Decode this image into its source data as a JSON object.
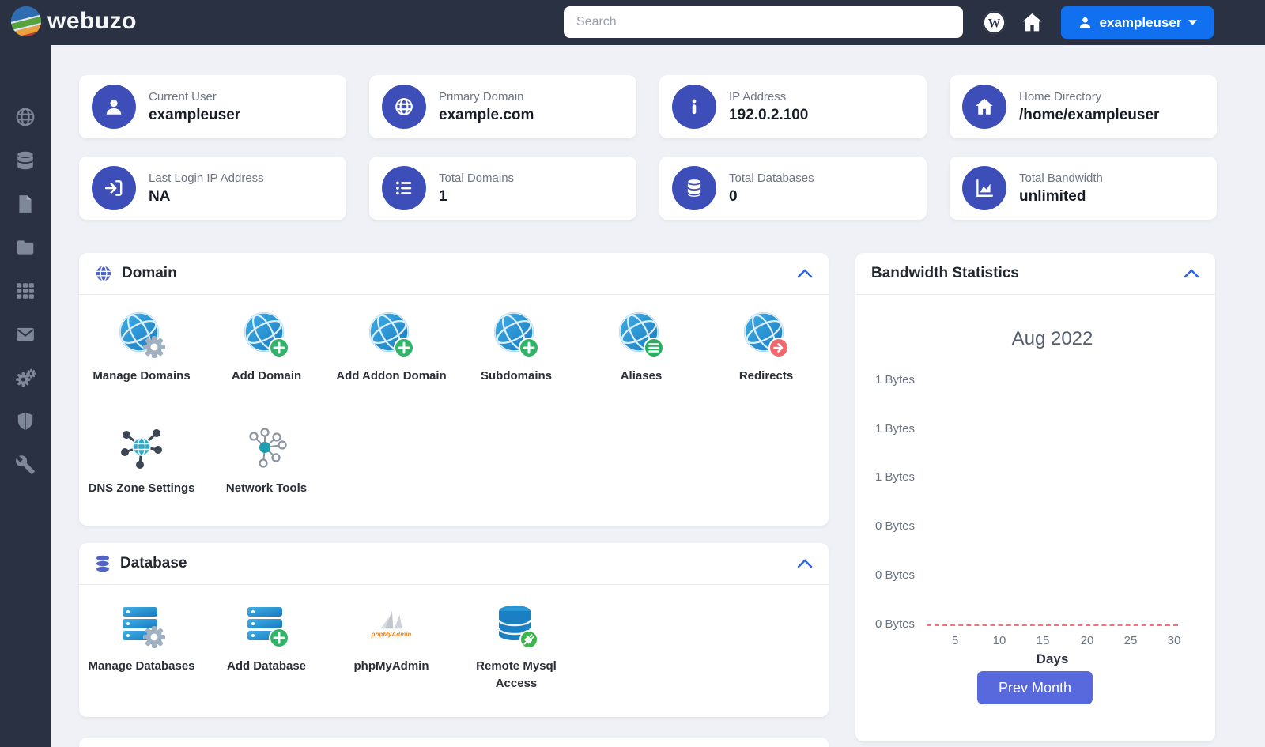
{
  "colors": {
    "topbar_bg": "#2a3142",
    "content_bg": "#eff1f6",
    "accent_blue": "#1170f0",
    "card_icon_bg": "#3d4eb8",
    "panel_header_icon": "#5163c5",
    "chevron_blue": "#2d66e4",
    "button_indigo": "#5868dd",
    "chart_dashed_line": "#f0737c",
    "tile_globe_blue": "#2196d3",
    "badge_green": "#2fb46a",
    "badge_red": "#ef6a6e",
    "badge_gear_gray": "#9fb0c0"
  },
  "topbar": {
    "logo_text": "webuzo",
    "search": {
      "placeholder": "Search"
    },
    "icons": [
      "wordpress-icon",
      "home-icon"
    ],
    "user_menu": {
      "label": "exampleuser",
      "icon": "user-icon",
      "has_dropdown": true
    }
  },
  "sidebar": {
    "items": [
      {
        "icon": "globe-icon"
      },
      {
        "icon": "database-icon"
      },
      {
        "icon": "file-icon"
      },
      {
        "icon": "folder-icon"
      },
      {
        "icon": "apps-grid-icon"
      },
      {
        "icon": "mail-icon"
      },
      {
        "icon": "settings-gears-icon"
      },
      {
        "icon": "shield-icon"
      },
      {
        "icon": "wrench-icon"
      }
    ]
  },
  "stats_cards": [
    {
      "icon": "user-icon",
      "label": "Current User",
      "value": "exampleuser"
    },
    {
      "icon": "globe-icon",
      "label": "Primary Domain",
      "value": "example.com"
    },
    {
      "icon": "info-icon",
      "label": "IP Address",
      "value": "192.0.2.100"
    },
    {
      "icon": "home-icon",
      "label": "Home Directory",
      "value": "/home/exampleuser"
    },
    {
      "icon": "sign-in-icon",
      "label": "Last Login IP Address",
      "value": "NA"
    },
    {
      "icon": "list-icon",
      "label": "Total Domains",
      "value": "1"
    },
    {
      "icon": "database-icon",
      "label": "Total Databases",
      "value": "0"
    },
    {
      "icon": "area-chart-icon",
      "label": "Total Bandwidth",
      "value": "unlimited"
    }
  ],
  "domain_panel": {
    "title": "Domain",
    "header_icon": "globe-icon",
    "collapse_icon": "chevron-up-icon",
    "items": [
      {
        "label": "Manage Domains",
        "icon": "globe-gear-icon"
      },
      {
        "label": "Add Domain",
        "icon": "globe-plus-icon"
      },
      {
        "label": "Add Addon Domain",
        "icon": "globe-plus-icon"
      },
      {
        "label": "Subdomains",
        "icon": "globe-plus-icon"
      },
      {
        "label": "Aliases",
        "icon": "globe-list-icon"
      },
      {
        "label": "Redirects",
        "icon": "globe-arrow-icon"
      },
      {
        "label": "DNS Zone Settings",
        "icon": "dns-network-icon"
      },
      {
        "label": "Network Tools",
        "icon": "network-nodes-icon"
      }
    ]
  },
  "database_panel": {
    "title": "Database",
    "header_icon": "database-icon",
    "collapse_icon": "chevron-up-icon",
    "items": [
      {
        "label": "Manage Databases",
        "icon": "server-gear-icon"
      },
      {
        "label": "Add Database",
        "icon": "server-plus-icon"
      },
      {
        "label": "phpMyAdmin",
        "icon": "phpmyadmin-logo"
      },
      {
        "label": "Remote Mysql Access",
        "icon": "database-plug-icon"
      }
    ]
  },
  "bandwidth_panel": {
    "title": "Bandwidth Statistics",
    "collapse_icon": "chevron-up-icon",
    "prev_month_label": "Prev Month",
    "chart_data": {
      "type": "line",
      "title": "Aug 2022",
      "xlabel": "Days",
      "ylabel": "",
      "x_tick_labels": [
        "5",
        "10",
        "15",
        "20",
        "25",
        "30"
      ],
      "y_tick_labels": [
        "1 Bytes",
        "1 Bytes",
        "1 Bytes",
        "0 Bytes",
        "0 Bytes",
        "0 Bytes"
      ],
      "x_range": [
        1,
        31
      ],
      "grid": false,
      "legend": false,
      "line_style": "dashed",
      "line_color": "#f0737c",
      "series": [
        {
          "name": "Bandwidth",
          "values": [
            0,
            0,
            0,
            0,
            0,
            0,
            0,
            0,
            0,
            0,
            0,
            0,
            0,
            0,
            0,
            0,
            0,
            0,
            0,
            0,
            0,
            0,
            0,
            0,
            0,
            0,
            0,
            0,
            0,
            0,
            0
          ]
        }
      ]
    }
  }
}
